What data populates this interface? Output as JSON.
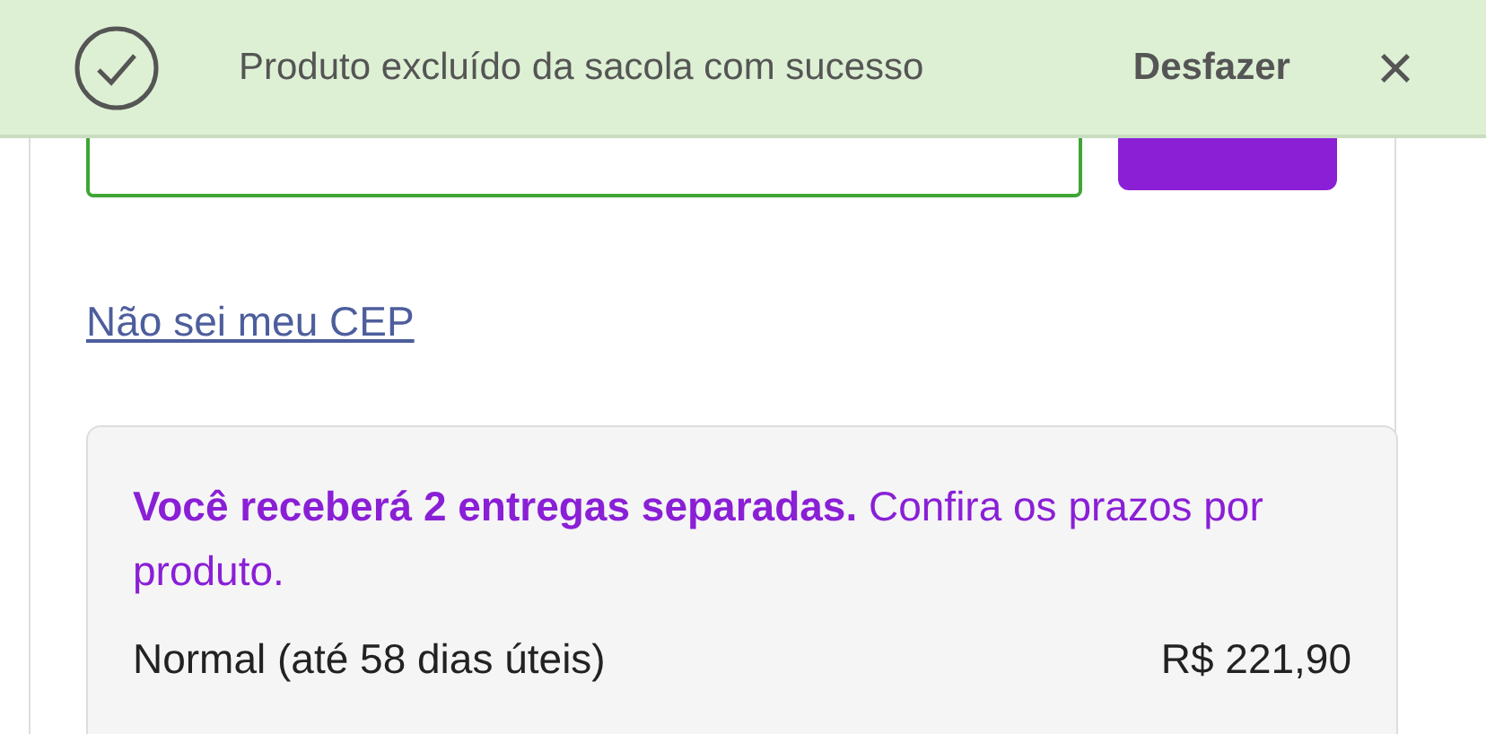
{
  "toast": {
    "message": "Produto excluído da sacola com sucesso",
    "action": "Desfazer",
    "close": "×"
  },
  "cep_field": {
    "valid": true
  },
  "cep_link": "Não sei meu CEP",
  "delivery": {
    "notice": "**Você receberá 2 entregas separadas.** Confira os prazos por produto.",
    "options": [
      {
        "name": "Normal (até 58 dias úteis)",
        "price": "R$ 221,90"
      }
    ]
  }
}
